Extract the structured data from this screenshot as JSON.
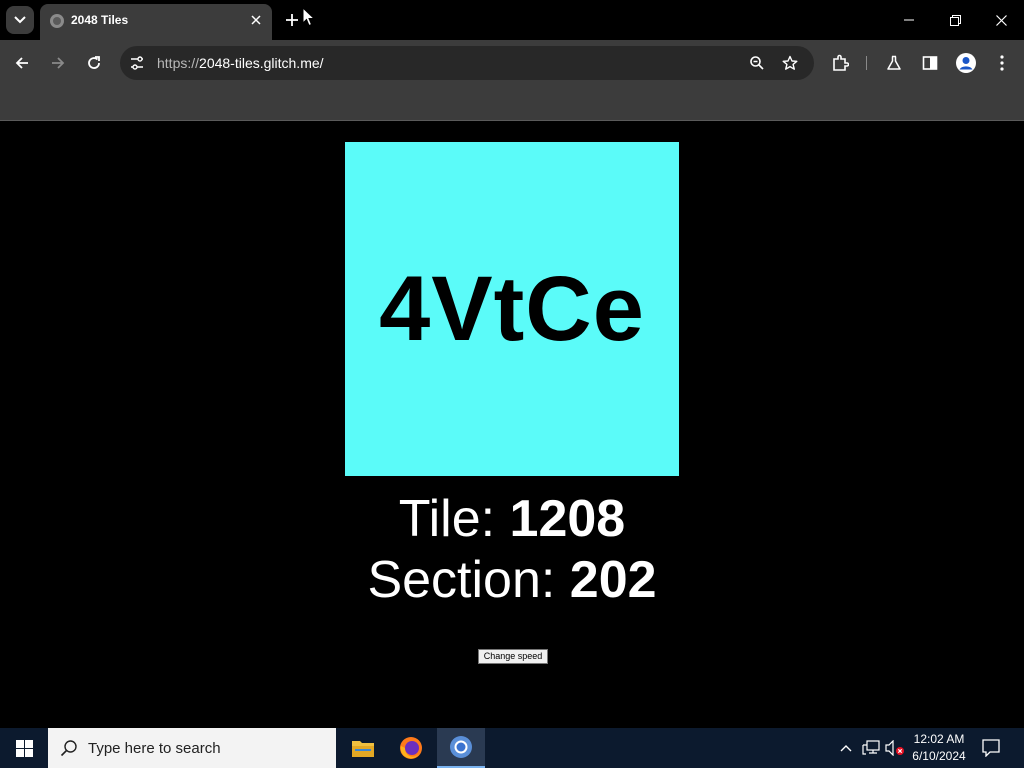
{
  "browser": {
    "tab_title": "2048 Tiles",
    "url_scheme": "https://",
    "url_host": "2048-tiles.glitch.me/"
  },
  "page": {
    "tile_code": "4VtCe",
    "tile_color": "#5bfbf9",
    "tile_label": "Tile: ",
    "tile_value": "1208",
    "section_label": "Section: ",
    "section_value": "202",
    "speed_button": "Change speed"
  },
  "taskbar": {
    "search_placeholder": "Type here to search",
    "time": "12:02 AM",
    "date": "6/10/2024"
  },
  "icons": [
    "tab-search-icon",
    "globe-icon",
    "close-icon",
    "plus-icon",
    "minimize-icon",
    "restore-icon",
    "back-icon",
    "forward-icon",
    "reload-icon",
    "site-info-icon",
    "zoom-icon",
    "star-icon",
    "extensions-icon",
    "labs-icon",
    "side-panel-icon",
    "profile-icon",
    "menu-icon",
    "windows-icon",
    "search-icon",
    "file-explorer-icon",
    "firefox-icon",
    "chrome-icon",
    "chevron-up-icon",
    "network-icon",
    "volume-muted-icon",
    "notifications-icon"
  ]
}
